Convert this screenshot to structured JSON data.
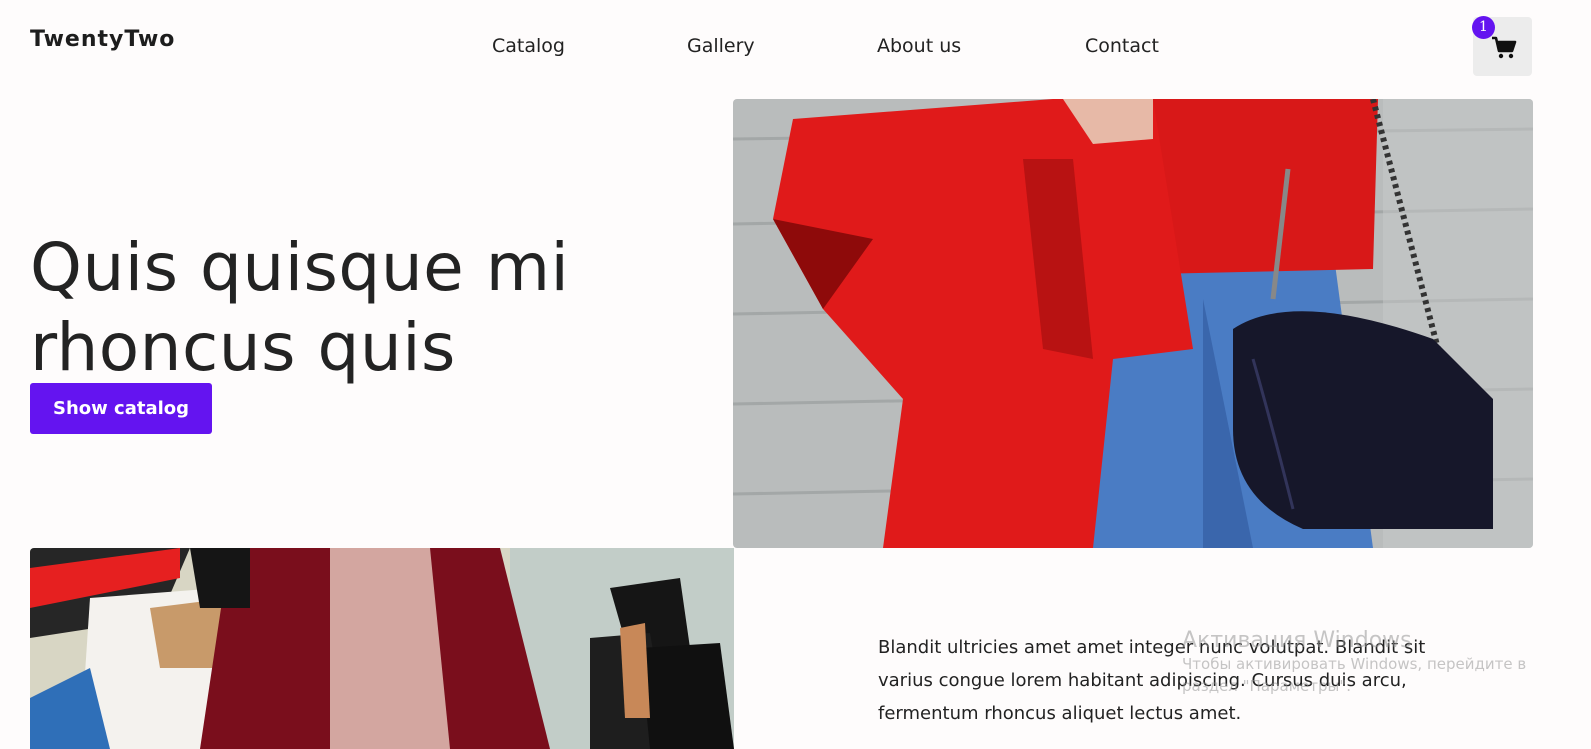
{
  "header": {
    "logo": "TwentyTwo",
    "nav": [
      "Catalog",
      "Gallery",
      "About us",
      "Contact"
    ],
    "cart_count": "1"
  },
  "hero": {
    "title": "Quis quisque mi rhoncus quis",
    "button_label": "Show catalog"
  },
  "images": {
    "right": "woman-red-coat-handbag-photo",
    "left": "woman-shopping-bags-photo"
  },
  "description": "Blandit ultricies amet amet integer nunc volutpat. Blandit sit varius congue lorem habitant adipiscing. Cursus duis arcu, fermentum rhoncus aliquet lectus amet.",
  "watermark": {
    "title": "Активация Windows",
    "line1": "Чтобы активировать Windows, перейдите в",
    "line2": "раздел \"Параметры\"."
  },
  "colors": {
    "accent": "#6414f0",
    "background": "#fefcfc"
  }
}
